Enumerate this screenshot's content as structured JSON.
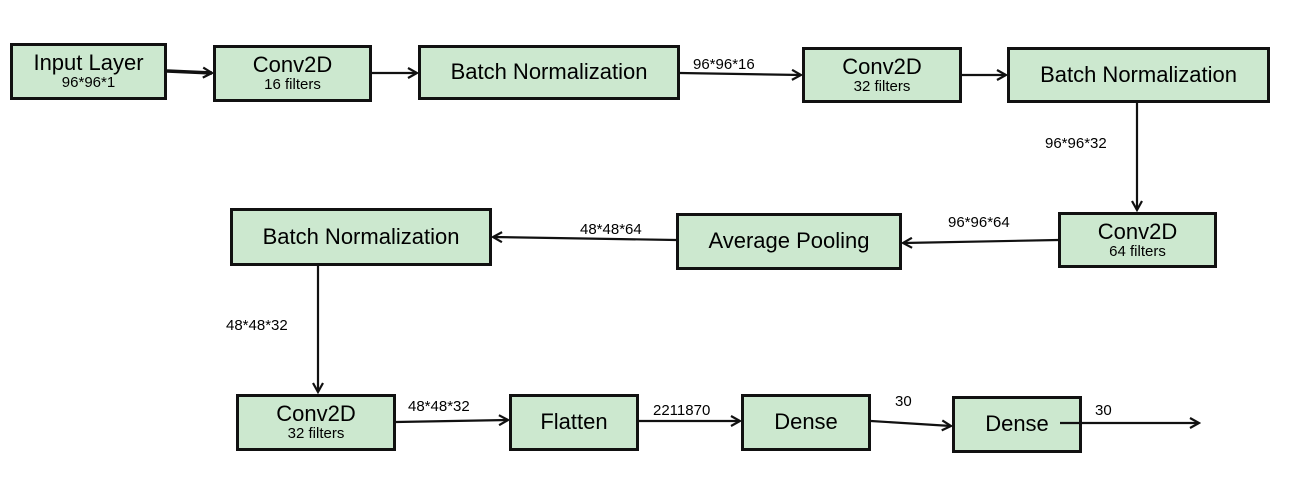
{
  "colors": {
    "box_fill": "#cce8cf",
    "border": "#111111"
  },
  "nodes": [
    {
      "title": "Input Layer",
      "sub": "96*96*1"
    },
    {
      "title": "Conv2D",
      "sub": "16 filters"
    },
    {
      "title": "Batch Normalization",
      "sub": ""
    },
    {
      "title": "Conv2D",
      "sub": "32 filters"
    },
    {
      "title": "Batch Normalization",
      "sub": ""
    },
    {
      "title": "Conv2D",
      "sub": "64 filters"
    },
    {
      "title": "Average Pooling",
      "sub": ""
    },
    {
      "title": "Batch Normalization",
      "sub": ""
    },
    {
      "title": "Conv2D",
      "sub": "32 filters"
    },
    {
      "title": "Flatten",
      "sub": ""
    },
    {
      "title": "Dense",
      "sub": ""
    },
    {
      "title": "Dense",
      "sub": ""
    }
  ],
  "edge_labels": [
    "96*96*16",
    "96*96*32",
    "96*96*64",
    "48*48*64",
    "48*48*32",
    "48*48*32",
    "2211870",
    "30",
    "30"
  ]
}
